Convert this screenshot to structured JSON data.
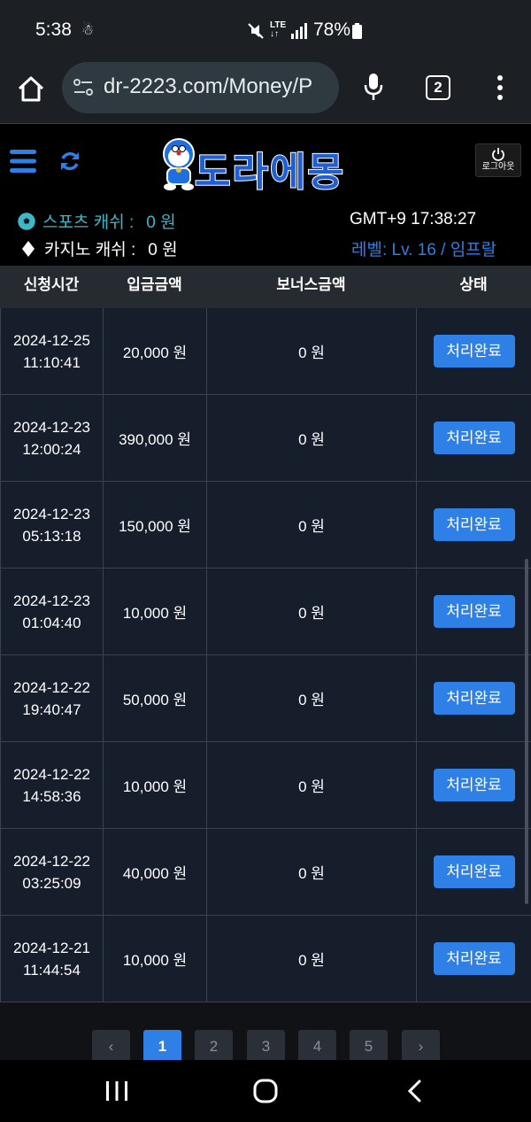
{
  "status_bar": {
    "time": "5:38",
    "network": "LTE",
    "battery": "78%"
  },
  "browser": {
    "url": "dr-2223.com/Money/P",
    "tab_count": "2"
  },
  "site": {
    "logo_text": "도라에몽",
    "logout_label": "로그아웃",
    "sports_label": "스포츠 캐쉬 :",
    "sports_value": "0 원",
    "casino_label": "카지노 캐쉬 :",
    "casino_value": "0 원",
    "clock": "GMT+9 17:38:27",
    "level": "레벨: Lv. 16 / 임프랄"
  },
  "table": {
    "headers": [
      "신청시간",
      "입금금액",
      "보너스금액",
      "상태"
    ],
    "rows": [
      {
        "date": "2024-12-25",
        "time": "11:10:41",
        "amount": "20,000 원",
        "bonus": "0 원",
        "status": "처리완료"
      },
      {
        "date": "2024-12-23",
        "time": "12:00:24",
        "amount": "390,000 원",
        "bonus": "0 원",
        "status": "처리완료"
      },
      {
        "date": "2024-12-23",
        "time": "05:13:18",
        "amount": "150,000 원",
        "bonus": "0 원",
        "status": "처리완료"
      },
      {
        "date": "2024-12-23",
        "time": "01:04:40",
        "amount": "10,000 원",
        "bonus": "0 원",
        "status": "처리완료"
      },
      {
        "date": "2024-12-22",
        "time": "19:40:47",
        "amount": "50,000 원",
        "bonus": "0 원",
        "status": "처리완료"
      },
      {
        "date": "2024-12-22",
        "time": "14:58:36",
        "amount": "10,000 원",
        "bonus": "0 원",
        "status": "처리완료"
      },
      {
        "date": "2024-12-22",
        "time": "03:25:09",
        "amount": "40,000 원",
        "bonus": "0 원",
        "status": "처리완료"
      },
      {
        "date": "2024-12-21",
        "time": "11:44:54",
        "amount": "10,000 원",
        "bonus": "0 원",
        "status": "처리완료"
      }
    ]
  },
  "pagination": {
    "prev": "‹",
    "pages": [
      "1",
      "2",
      "3",
      "4",
      "5"
    ],
    "active_page": "1",
    "next": "›"
  },
  "colors": {
    "accent": "#2f80e6",
    "table_bg": "#161d2b",
    "sports_text": "#3fb7c9",
    "level_text": "#2f7fe0"
  }
}
